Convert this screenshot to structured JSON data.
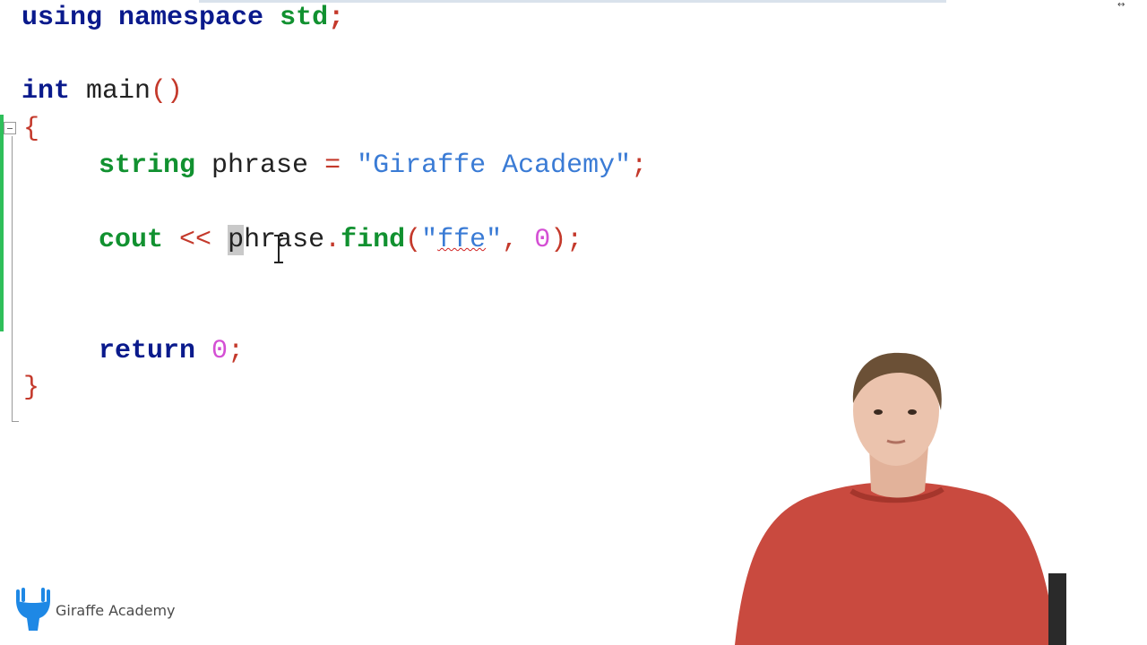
{
  "editor": {
    "line1": {
      "kw": "using",
      "kw2": "namespace",
      "name": "std",
      "semi": ";"
    },
    "line2": {
      "type": "int",
      "name": "main",
      "parens": "()"
    },
    "open_brace": "{",
    "line3": {
      "type": "string",
      "var": "phrase",
      "eq": "=",
      "str": "\"Giraffe Academy\"",
      "semi": ";"
    },
    "line4": {
      "cout": "cout",
      "op": "<<",
      "sel": "p",
      "var_rest": "hrase",
      "dot": ".",
      "method": "find",
      "lp": "(",
      "q1": "\"",
      "str": "ffe",
      "q2": "\"",
      "comma": ",",
      "num": "0",
      "rp": ")",
      "semi": ";"
    },
    "line5": {
      "kw": "return",
      "num": "0",
      "semi": ";"
    },
    "close_brace": "}"
  },
  "branding": {
    "logo_text": "Giraffe Academy",
    "logo_icon": "giraffe-hand-icon"
  },
  "colors": {
    "keyword": "#0a1a8c",
    "type_green": "#119130",
    "string": "#3a7bd5",
    "number": "#d44fd4",
    "brace": "#c4392b",
    "change_bar": "#2fbf5a"
  }
}
